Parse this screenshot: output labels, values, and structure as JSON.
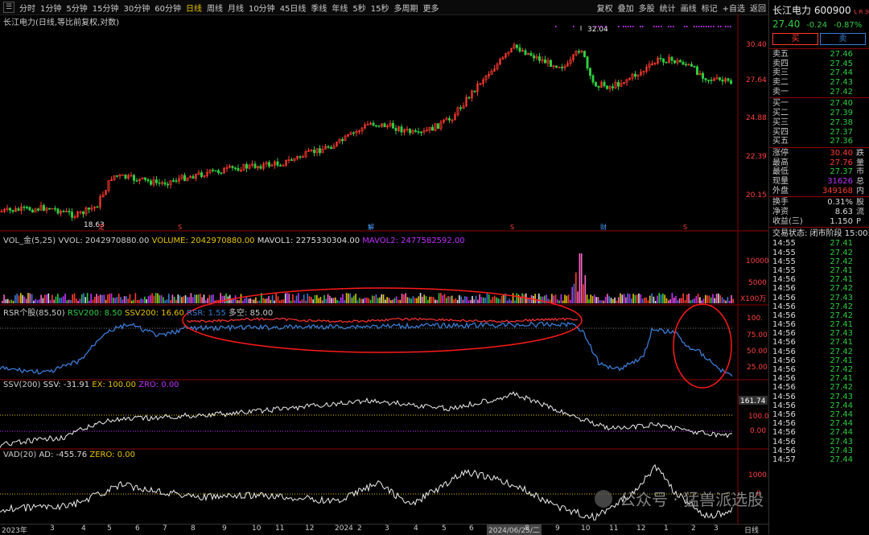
{
  "toolbar": {
    "periods": [
      "分时",
      "1分钟",
      "5分钟",
      "15分钟",
      "30分钟",
      "60分钟",
      "日线",
      "周线",
      "月线",
      "10分钟",
      "45日线",
      "季线",
      "年线",
      "5秒",
      "15秒",
      "多周期",
      "更多"
    ],
    "active_period": "日线",
    "tools": [
      "复权",
      "叠加",
      "多股",
      "统计",
      "画线",
      "标记",
      "+自选",
      "返回"
    ]
  },
  "main_chart": {
    "title": "长江电力(日线,等比前复权,对数)",
    "y_ticks": [
      "30.40",
      "27.64",
      "24.88",
      "22.39",
      "20.15"
    ],
    "high_marker": "32.04",
    "low_marker": "18.63",
    "event_markers": [
      "定",
      "S",
      "S",
      "解",
      "S",
      "财",
      "S"
    ]
  },
  "volume_panel": {
    "label": "VOL_金(5,25)",
    "vvol": "VVOL: 2042970880.00",
    "volume": "VOLUME: 2042970880.00",
    "mavol1": "MAVOL1: 2275330304.00",
    "mavol2": "MAVOL2: 2477582592.00",
    "y_ticks": [
      "10000",
      "5000"
    ],
    "unit": "X100万"
  },
  "rsr_panel": {
    "label": "RSR个股(85,50)",
    "rsv200": "RSV200: 8.50",
    "ssv200": "SSV200: 16.60",
    "rsr": "RSR: 1.55",
    "duokong": "多空: 85.00",
    "y_ticks": [
      "100.",
      "75.00",
      "50.00",
      "25.00"
    ]
  },
  "ssv_panel": {
    "label": "SSV(200)",
    "ssv": "SSV: -31.91",
    "ex": "EX: 100.00",
    "zro": "ZRO: 0.00",
    "value_box": "161.74",
    "y_ticks": [
      "100.0",
      "0.00"
    ]
  },
  "vad_panel": {
    "label": "VAD(20)",
    "ad": "AD: -455.76",
    "zero": "ZERO: 0.00",
    "y_ticks": [
      "1000",
      "0"
    ]
  },
  "x_axis": {
    "labels": [
      "2023年",
      "3",
      "4",
      "5",
      "6",
      "7",
      "8",
      "9",
      "10",
      "11",
      "12",
      "2024",
      "2",
      "3",
      "4",
      "5",
      "6",
      "2024/06/25/二",
      "8",
      "9",
      "10",
      "11",
      "12",
      "1",
      "2",
      "3"
    ],
    "period_label": "日线"
  },
  "watermark": "公众号 · 猛兽派选股",
  "quote": {
    "name": "长江电力",
    "code": "600900",
    "tags": "L R 300",
    "price": "27.40",
    "change": "-0.24",
    "pct": "-0.87%",
    "buy_btn": "买",
    "sell_btn": "卖",
    "asks": [
      {
        "k": "卖五",
        "v": "27.46"
      },
      {
        "k": "卖四",
        "v": "27.45"
      },
      {
        "k": "卖三",
        "v": "27.44"
      },
      {
        "k": "卖二",
        "v": "27.43"
      },
      {
        "k": "卖一",
        "v": "27.42"
      }
    ],
    "bids": [
      {
        "k": "买一",
        "v": "27.40"
      },
      {
        "k": "买二",
        "v": "27.39"
      },
      {
        "k": "买三",
        "v": "27.38"
      },
      {
        "k": "买四",
        "v": "27.37"
      },
      {
        "k": "买五",
        "v": "27.36"
      }
    ],
    "stats": [
      {
        "k": "涨停",
        "v": "30.40",
        "x": "跌",
        "c": "r"
      },
      {
        "k": "最高",
        "v": "27.76",
        "x": "量",
        "c": "r"
      },
      {
        "k": "最低",
        "v": "27.37",
        "x": "市",
        "c": "g"
      },
      {
        "k": "现量",
        "v": "31626",
        "x": "总",
        "c": "m"
      },
      {
        "k": "外盘",
        "v": "349168",
        "x": "内",
        "c": "r"
      }
    ],
    "stats2": [
      {
        "k": "换手",
        "v": "0.31%",
        "x": "股"
      },
      {
        "k": "净资",
        "v": "8.63",
        "x": "流"
      },
      {
        "k": "收益(三)",
        "v": "1.150",
        "x": "P"
      }
    ],
    "status": "交易状态: 闭市阶段 15:00:0",
    "ticks": [
      {
        "t": "14:55",
        "p": "27.41"
      },
      {
        "t": "14:55",
        "p": "27.42"
      },
      {
        "t": "14:55",
        "p": "27.42"
      },
      {
        "t": "14:55",
        "p": "27.41"
      },
      {
        "t": "14:56",
        "p": "27.41"
      },
      {
        "t": "14:56",
        "p": "27.42"
      },
      {
        "t": "14:56",
        "p": "27.43"
      },
      {
        "t": "14:56",
        "p": "27.42"
      },
      {
        "t": "14:56",
        "p": "27.42"
      },
      {
        "t": "14:56",
        "p": "27.41"
      },
      {
        "t": "14:56",
        "p": "27.43"
      },
      {
        "t": "14:56",
        "p": "27.41"
      },
      {
        "t": "14:56",
        "p": "27.42"
      },
      {
        "t": "14:56",
        "p": "27.41"
      },
      {
        "t": "14:56",
        "p": "27.42"
      },
      {
        "t": "14:56",
        "p": "27.41"
      },
      {
        "t": "14:56",
        "p": "27.42"
      },
      {
        "t": "14:56",
        "p": "27.43"
      },
      {
        "t": "14:56",
        "p": "27.44"
      },
      {
        "t": "14:56",
        "p": "27.44"
      },
      {
        "t": "14:56",
        "p": "27.44"
      },
      {
        "t": "14:56",
        "p": "27.44"
      },
      {
        "t": "14:56",
        "p": "27.43"
      },
      {
        "t": "14:56",
        "p": "27.43"
      },
      {
        "t": "14:57",
        "p": "27.44"
      }
    ]
  },
  "colors": {
    "up": "#ff3b30",
    "down": "#2ecc40",
    "accent": "#e6c200",
    "ellipse": "#ff1a1a"
  }
}
